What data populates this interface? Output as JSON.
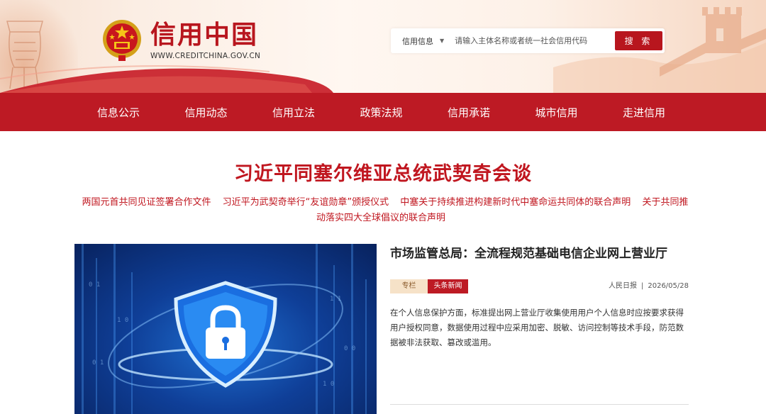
{
  "site": {
    "title": "信用中国",
    "url": "WWW.CREDITCHINA.GOV.CN"
  },
  "search": {
    "type_label": "信用信息",
    "placeholder": "请输入主体名称或者统一社会信用代码",
    "button_label": "搜 索"
  },
  "nav": {
    "items": [
      "信息公示",
      "信用动态",
      "信用立法",
      "政策法规",
      "信用承诺",
      "城市信用",
      "走进信用"
    ]
  },
  "headline": {
    "title": "习近平同塞尔维亚总统武契奇会谈",
    "links": [
      "两国元首共同见证签署合作文件",
      "习近平为武契奇举行“友谊勋章”颁授仪式",
      "中塞关于持续推进构建新时代中塞命运共同体的联合声明",
      "关于共同推动落实四大全球倡议的联合声明"
    ]
  },
  "feature": {
    "title": "市场监管总局：全流程规范基础电信企业网上营业厅",
    "tag_column": "专栏",
    "tag_headline": "头条新闻",
    "source": "人民日报",
    "separator": "|",
    "date": "2026/05/28",
    "summary": "在个人信息保护方面，标准提出网上营业厅收集使用用户个人信息时应按要求获得用户授权同意，数据使用过程中应采用加密、脱敏、访问控制等技术手段，防范数据被非法获取、篡改或滥用。"
  },
  "colors": {
    "brand_red": "#bd1a24",
    "title_red": "#c0161f",
    "tag_beige": "#f6e2c8"
  },
  "icons": [
    "national-emblem-icon",
    "caret-down-icon",
    "shield-lock-icon"
  ]
}
